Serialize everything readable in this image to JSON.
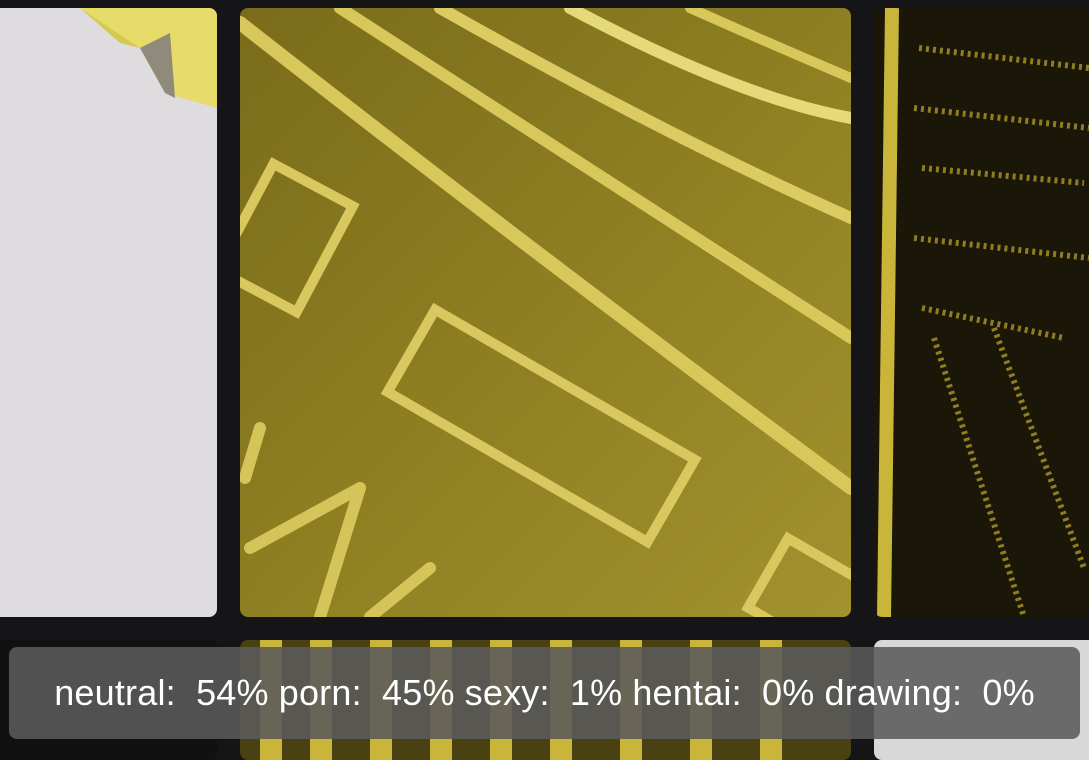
{
  "gallery": {
    "tiles": [
      {
        "name": "gallery-tile-1",
        "subject": "white surface with gold corner"
      },
      {
        "name": "gallery-tile-2",
        "subject": "gold engraved metal close-up"
      },
      {
        "name": "gallery-tile-3",
        "subject": "dark surface with gold dotted text"
      },
      {
        "name": "gallery-tile-4",
        "subject": "dark tile"
      },
      {
        "name": "gallery-tile-5",
        "subject": "gold striped metal"
      },
      {
        "name": "gallery-tile-6",
        "subject": "light gray tile"
      }
    ]
  },
  "classification": {
    "items": [
      {
        "label": "neutral",
        "value": "54%"
      },
      {
        "label": "porn",
        "value": "45%"
      },
      {
        "label": "sexy",
        "value": "1%"
      },
      {
        "label": "hentai",
        "value": "0%"
      },
      {
        "label": "drawing",
        "value": "0%"
      }
    ]
  },
  "colors": {
    "background": "#151517",
    "gold": "#c9b53a",
    "gold_light": "#e6d97a",
    "overlay_bg": "#5a5a5a",
    "overlay_text": "#ffffff"
  }
}
